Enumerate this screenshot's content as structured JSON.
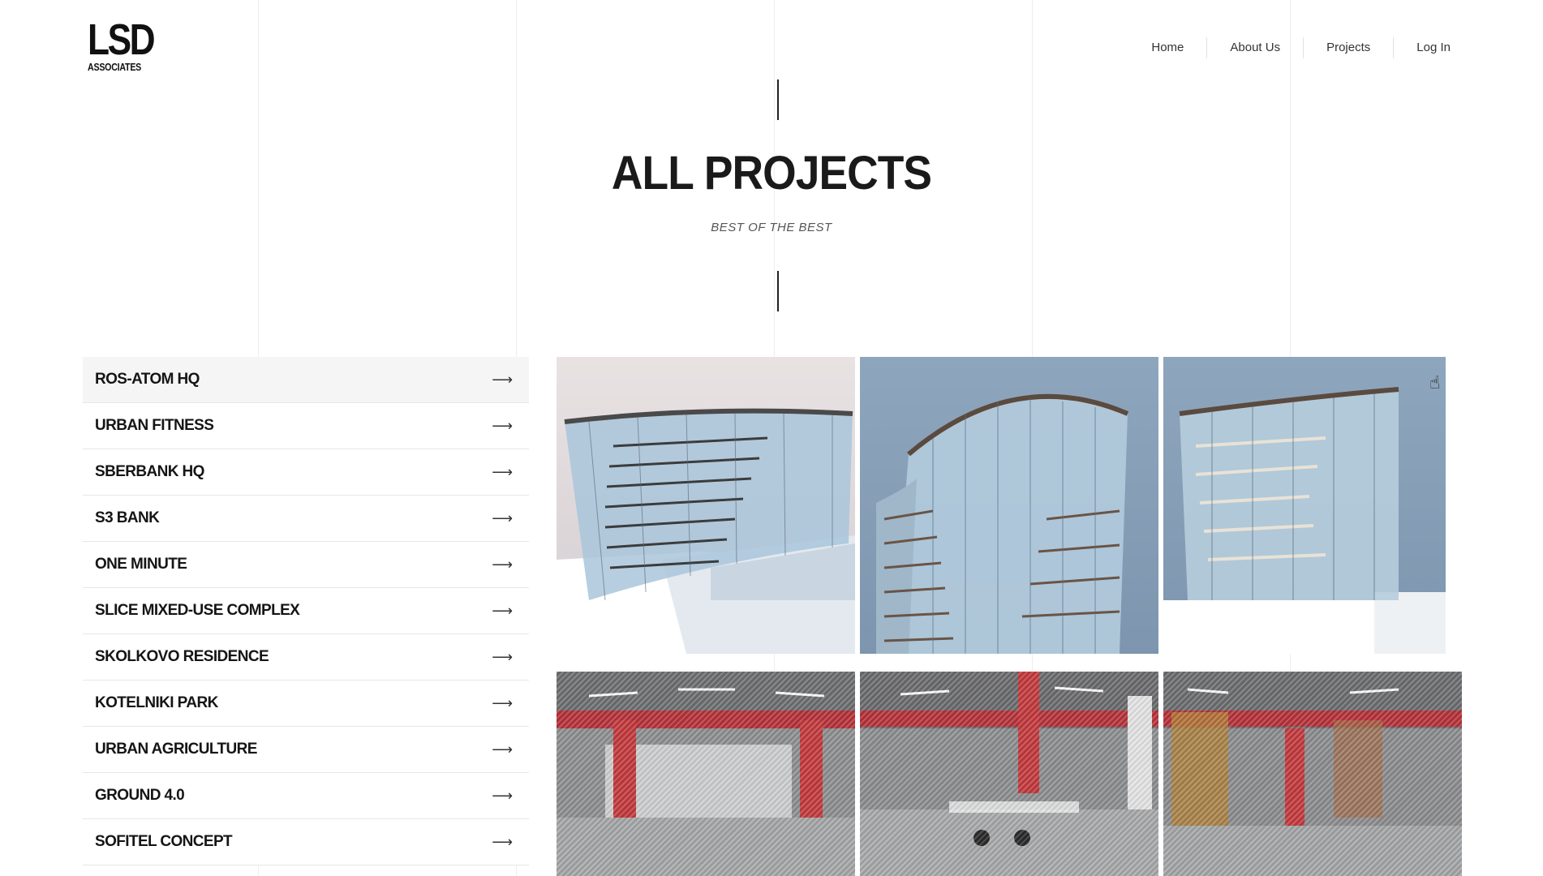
{
  "brand": {
    "logo_main": "LSD",
    "logo_sub": "ASSOCIATES"
  },
  "nav": {
    "items": [
      "Home",
      "About Us",
      "Projects",
      "Log In"
    ]
  },
  "hero": {
    "title": "ALL PROJECTS",
    "subtitle": "BEST OF THE BEST"
  },
  "projects": {
    "arrow": "⟶",
    "active_index": 0,
    "items": [
      "ROS-ATOM HQ",
      "URBAN FITNESS",
      "SBERBANK HQ",
      "S3 BANK",
      "ONE MINUTE",
      "SLICE MIXED-USE COMPLEX",
      "SKOLKOVO RESIDENCE",
      "KOTELNIKI PARK",
      "URBAN AGRICULTURE",
      "GROUND 4.0",
      "SOFITEL CONCEPT"
    ]
  },
  "gallery": {
    "row1": [
      "building-render",
      "building-render",
      "building-render"
    ],
    "row2": [
      "gym-interior-render",
      "gym-interior-render",
      "gym-interior-render"
    ]
  },
  "colors": {
    "text": "#111111",
    "accent_red": "#c43a3e",
    "glass": "#a9c6db",
    "sky": "#8ea6bd"
  }
}
